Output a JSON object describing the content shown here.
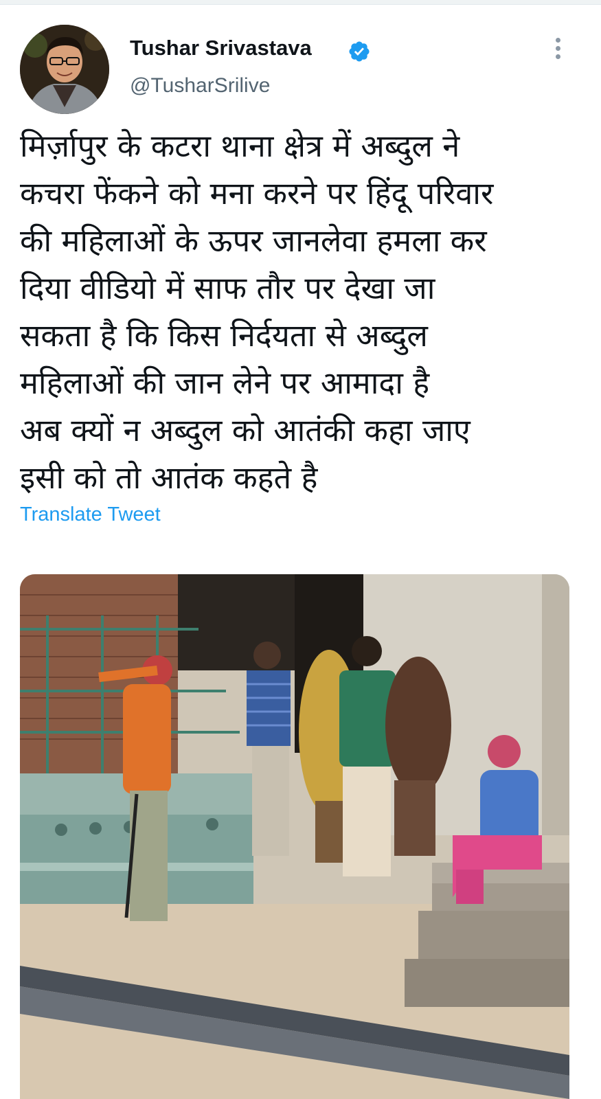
{
  "tweet": {
    "author": {
      "display_name": "Tushar Srivastava",
      "handle": "@TusharSrilive",
      "verified": true,
      "avatar_icon": "user-avatar"
    },
    "text": "मिर्ज़ापुर के कटरा थाना क्षेत्र में अब्दुल ने\nकचरा फेंकने को मना करने पर हिंदू परिवार\nकी महिलाओं के ऊपर जानलेवा हमला कर\nदिया वीडियो में साफ तौर पर देखा जा\nसकता है कि किस निर्दयता से अब्दुल\nमहिलाओं की जान लेने पर आमादा है\nअब क्यों न अब्दुल को आतंकी कहा जाए\nइसी को तो आतंक कहते है",
    "translate_label": "Translate Tweet",
    "more_icon": "more-vertical-icon",
    "media": {
      "type": "video-still",
      "icon": "video-frame"
    }
  },
  "colors": {
    "text_primary": "#0f1419",
    "text_secondary": "#536471",
    "link": "#1d9bf0",
    "verified_badge": "#1d9bf0",
    "background": "#ffffff"
  }
}
